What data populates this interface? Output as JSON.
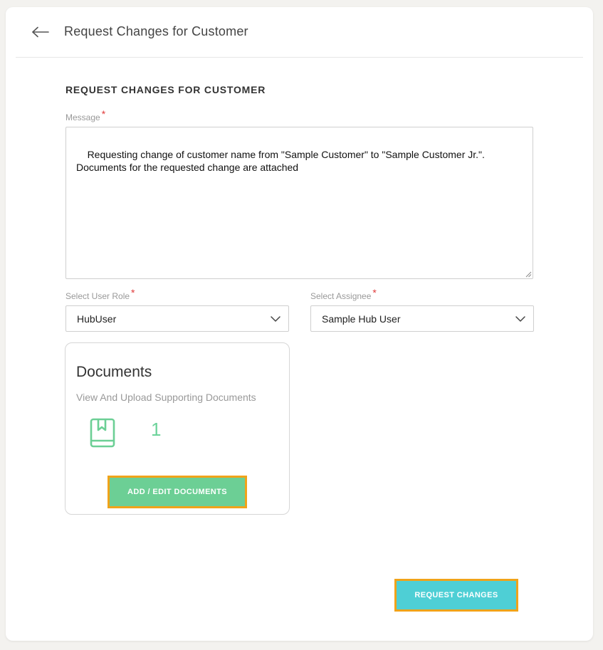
{
  "header": {
    "back_icon": "arrow-left-icon",
    "title": "Request Changes for Customer"
  },
  "form": {
    "section_title": "REQUEST CHANGES FOR CUSTOMER",
    "message": {
      "label": "Message",
      "required_marker": "*",
      "value": "Requesting change of customer name from \"Sample Customer\" to \"Sample Customer Jr.\".\nDocuments for the requested change are attached"
    },
    "user_role": {
      "label": "Select User Role",
      "required_marker": "*",
      "value": "HubUser"
    },
    "assignee": {
      "label": "Select Assignee",
      "required_marker": "*",
      "value": "Sample Hub User"
    }
  },
  "documents": {
    "title": "Documents",
    "subtitle": "View And Upload Supporting Documents",
    "icon": "book-bookmark-icon",
    "count": "1",
    "button_label": "ADD / EDIT DOCUMENTS"
  },
  "actions": {
    "submit_label": "REQUEST CHANGES"
  },
  "colors": {
    "accent_green": "#6ccf95",
    "accent_teal": "#4ecfd5",
    "highlight_border": "#f0a31a",
    "required": "#e03a3a"
  }
}
